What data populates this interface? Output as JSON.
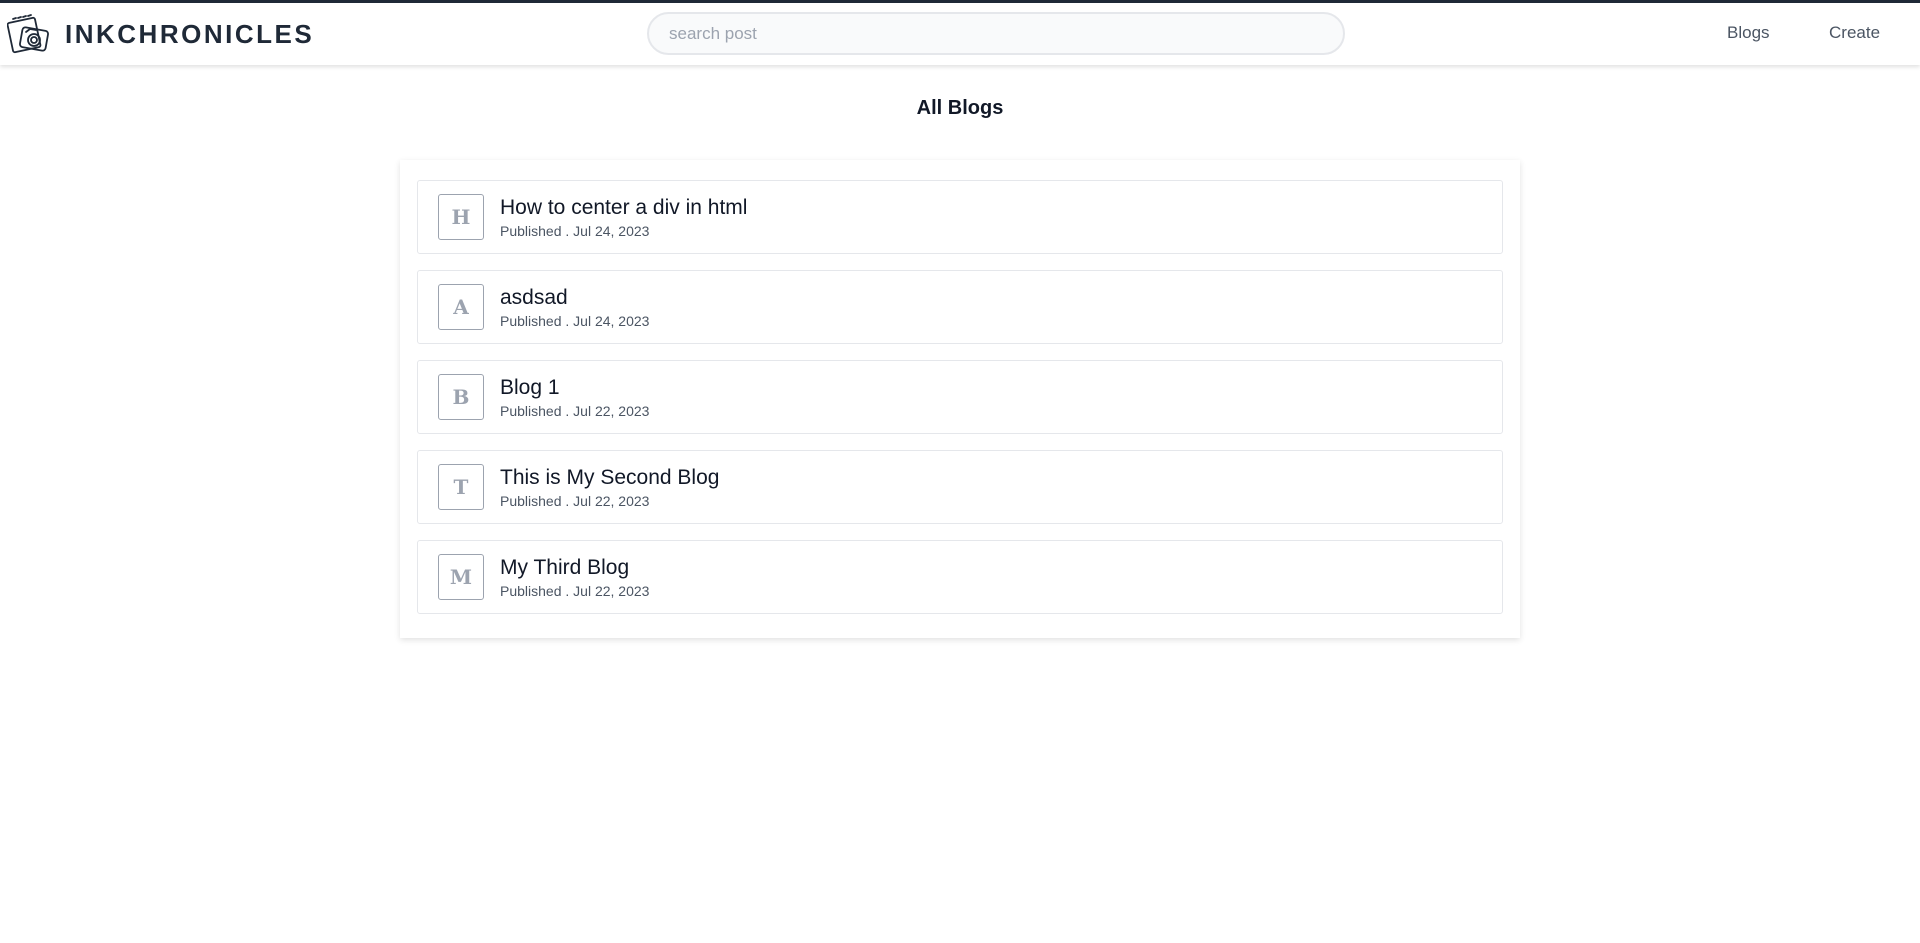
{
  "header": {
    "brand": "INKCHRONICLES",
    "logo_icon": "camera-notebook-logo-icon",
    "search_placeholder": "search post",
    "search_value": "",
    "nav": [
      {
        "label": "Blogs"
      },
      {
        "label": "Create"
      }
    ]
  },
  "main": {
    "title": "All Blogs",
    "posts": [
      {
        "initial": "H",
        "title": "How to center a div in html",
        "status": "Published",
        "date": "Jul 24, 2023",
        "meta": "Published . Jul 24, 2023"
      },
      {
        "initial": "A",
        "title": "asdsad",
        "status": "Published",
        "date": "Jul 24, 2023",
        "meta": "Published . Jul 24, 2023"
      },
      {
        "initial": "B",
        "title": "Blog 1",
        "status": "Published",
        "date": "Jul 22, 2023",
        "meta": "Published . Jul 22, 2023"
      },
      {
        "initial": "T",
        "title": "This is My Second Blog",
        "status": "Published",
        "date": "Jul 22, 2023",
        "meta": "Published . Jul 22, 2023"
      },
      {
        "initial": "M",
        "title": "My Third Blog",
        "status": "Published",
        "date": "Jul 22, 2023",
        "meta": "Published . Jul 22, 2023"
      }
    ]
  },
  "colors": {
    "top_border": "#1f2937",
    "brand_text": "#1f2937",
    "nav_text": "#4b5563",
    "avatar_border": "#9ca3af",
    "card_border": "#e5e7eb"
  }
}
